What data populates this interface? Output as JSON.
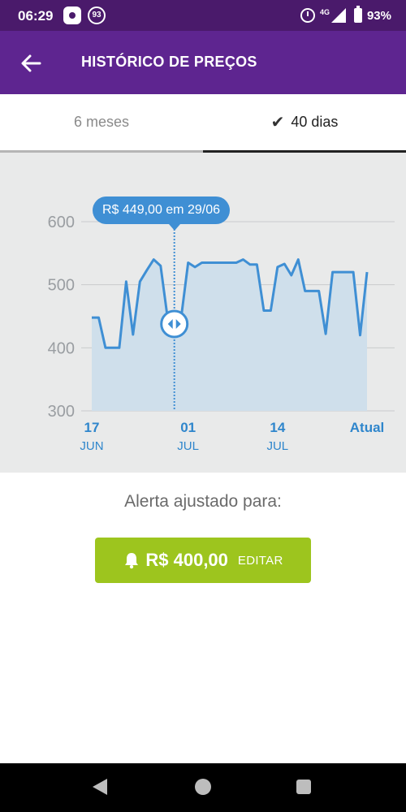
{
  "status_bar": {
    "time": "06:29",
    "notification_badge": "93",
    "network": "4G",
    "battery": "93%"
  },
  "app_bar": {
    "title": "HISTÓRICO DE PREÇOS",
    "back_icon": "arrow-left-icon"
  },
  "tabs": [
    {
      "label": "6 meses",
      "selected": false
    },
    {
      "label": "40 dias",
      "selected": true,
      "icon": "check-icon"
    }
  ],
  "tooltip": "R$ 449,00 em 29/06",
  "chart_data": {
    "type": "area",
    "y_ticks": [
      "600",
      "500",
      "400",
      "300"
    ],
    "ylim": [
      300,
      600
    ],
    "x_ticks": [
      {
        "day": "17",
        "month": "JUN"
      },
      {
        "day": "01",
        "month": "JUL"
      },
      {
        "day": "14",
        "month": "JUL"
      },
      {
        "day": "Atual",
        "month": ""
      }
    ],
    "series": [
      {
        "values": [
          448,
          448,
          400,
          400,
          400,
          505,
          421,
          505,
          523,
          540,
          530,
          449,
          449,
          449,
          535,
          528,
          535,
          535,
          535,
          535,
          535,
          535,
          540,
          532,
          532,
          459,
          459,
          528,
          533,
          515,
          540,
          490,
          490,
          490,
          422,
          520,
          520,
          520,
          520,
          420,
          520
        ]
      }
    ],
    "selected_index": 12,
    "grid": true,
    "accent_color": "#3f8fd4"
  },
  "alert": {
    "label": "Alerta ajustado para:",
    "price": "R$  400,00",
    "edit_label": "EDITAR",
    "icon": "bell-icon",
    "color": "#9dc51e"
  },
  "nav": {
    "back": "nav-back-icon",
    "home": "nav-home-icon",
    "recent": "nav-recent-icon"
  }
}
